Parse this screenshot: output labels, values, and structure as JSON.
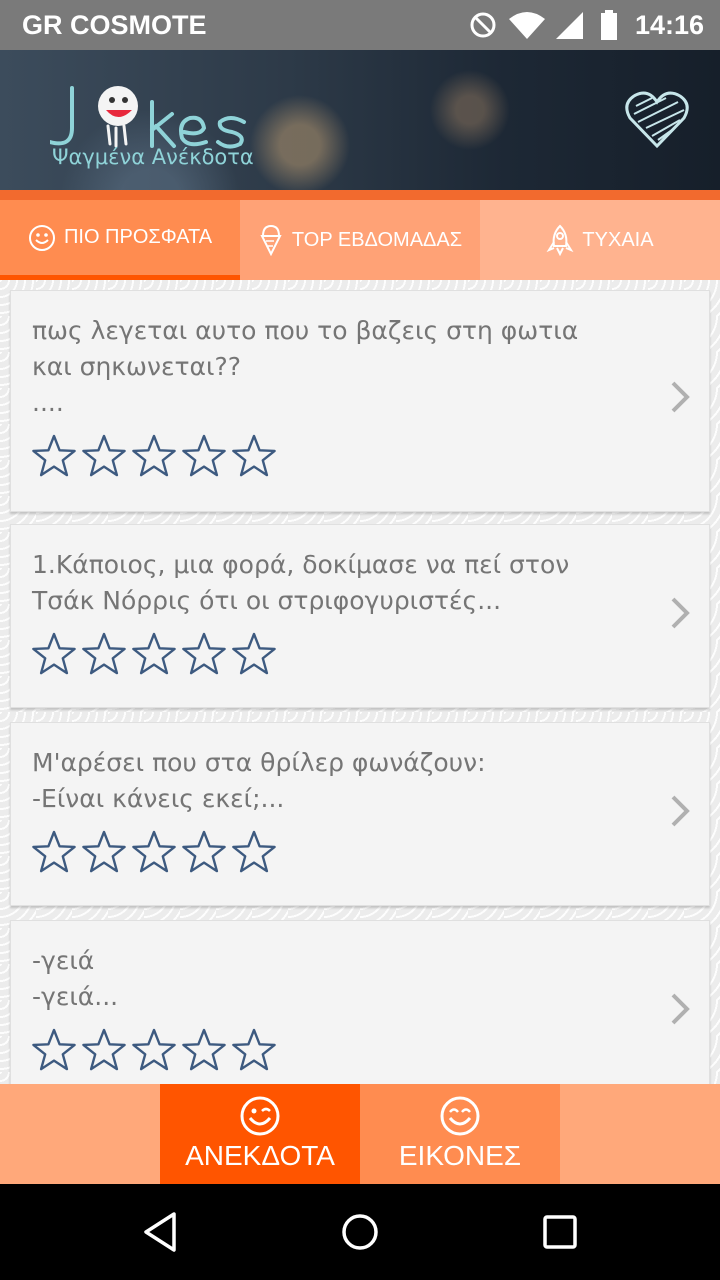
{
  "status_bar": {
    "carrier": "GR COSMOTE",
    "time": "14:16",
    "icons": [
      "do-not-disturb-icon",
      "wifi-icon",
      "signal-icon",
      "battery-icon"
    ]
  },
  "header": {
    "logo_text": "Jokes",
    "subtitle": "Ψαγμένα Ανέκδοτα",
    "favorites_icon": "heart-icon"
  },
  "tabs": [
    {
      "label": "ΠΙΟ ΠΡΟΣΦΑΤΑ",
      "icon": "smiley-icon",
      "selected": true
    },
    {
      "label": "TOP ΕΒΔΟΜΑΔΑΣ",
      "icon": "ice-cream-icon",
      "selected": false
    },
    {
      "label": "ΤΥΧΑΙΑ",
      "icon": "rocket-icon",
      "selected": false
    }
  ],
  "jokes": [
    {
      "text": "πως λεγεται αυτο που το βαζεις στη φωτια\nκαι σηκωνεται??\n....",
      "rating": 0,
      "max_rating": 5
    },
    {
      "text": "1.Κάποιος, μια φορά, δοκίμασε να πεί στον\nΤσάκ Νόρρις ότι οι στριφογυριστές...",
      "rating": 0,
      "max_rating": 5
    },
    {
      "text": "Μ'αρέσει που στα θρίλερ φωνάζουν:\n-Είναι κάνεις εκεί;...",
      "rating": 0,
      "max_rating": 5
    },
    {
      "text": "-γειά\n-γειά...",
      "rating": 0,
      "max_rating": 5
    }
  ],
  "bottom_nav": [
    {
      "label": "ΑΝΕΚΔΟΤΑ",
      "icon": "wink-face-icon",
      "selected": true
    },
    {
      "label": "ΕΙΚΟΝΕΣ",
      "icon": "happy-face-icon",
      "selected": false
    }
  ],
  "colors": {
    "accent": "#ff5500",
    "tab_selected": "#ff8c50",
    "tab_bg": "#ffa276",
    "star_outline": "#3d5a80",
    "subtitle": "#8fd3d8"
  }
}
